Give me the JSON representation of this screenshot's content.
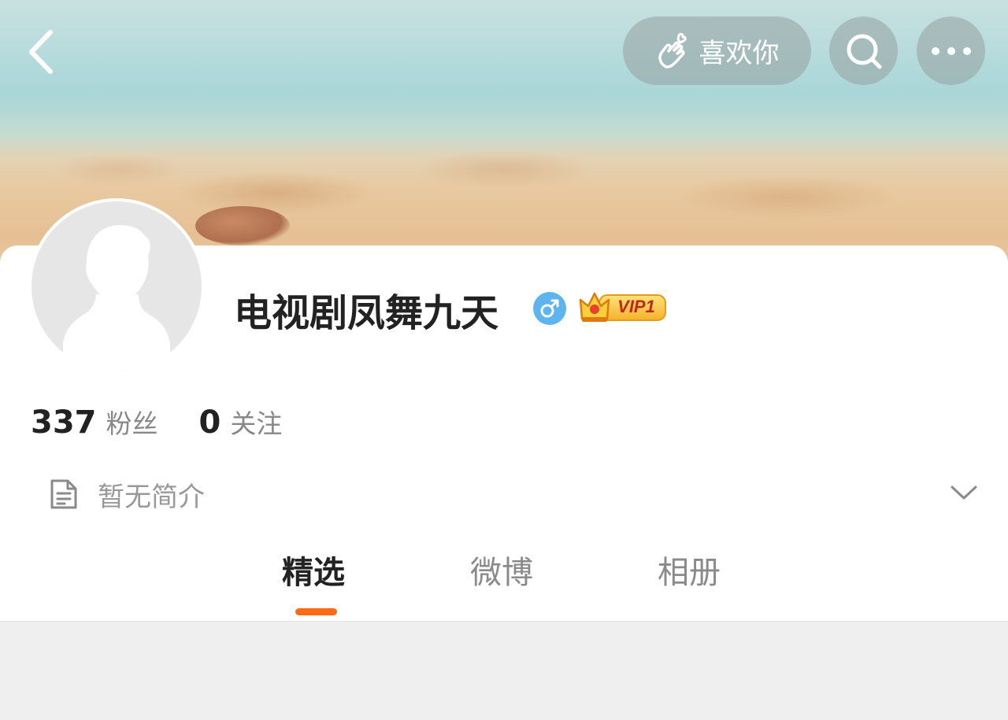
{
  "header": {
    "like_label": "喜欢你"
  },
  "profile": {
    "name": "电视剧凤舞九天",
    "gender": "male",
    "vip_label": "VIP1"
  },
  "stats": {
    "followers_count": "337",
    "followers_label": "粉丝",
    "following_count": "0",
    "following_label": "关注"
  },
  "bio": {
    "text": "暂无简介"
  },
  "tabs": [
    {
      "label": "精选",
      "active": true
    },
    {
      "label": "微博",
      "active": false
    },
    {
      "label": "相册",
      "active": false
    }
  ],
  "colors": {
    "accent": "#ff6a13",
    "gender_badge": "#5eb4ee",
    "vip_text": "#c0281b"
  },
  "icons": {
    "back": "chevron-left-icon",
    "like": "hand-heart-icon",
    "search": "search-icon",
    "more": "more-dots-icon",
    "gender": "male-symbol-icon",
    "vip": "crown-icon",
    "bio": "document-icon",
    "expand": "chevron-down-icon"
  }
}
